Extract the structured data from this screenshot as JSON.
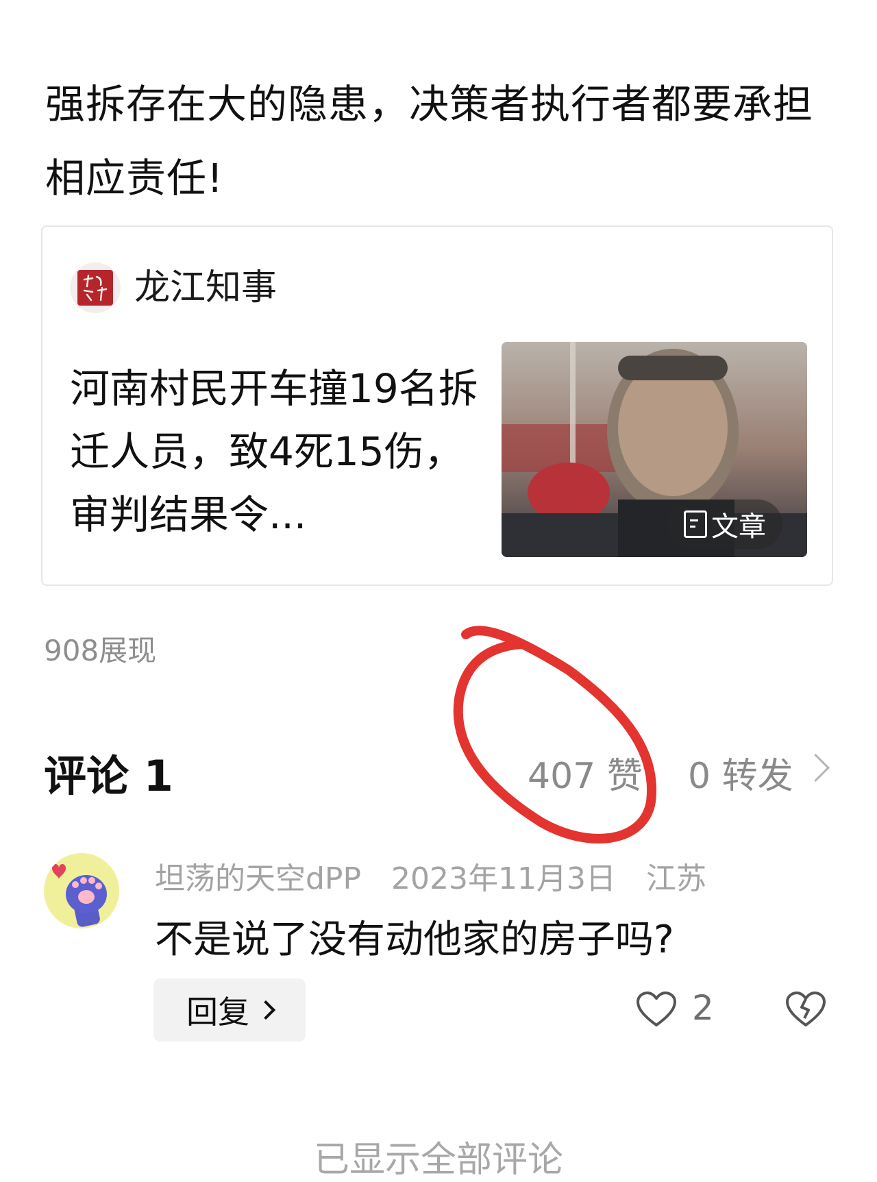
{
  "post": {
    "text": "强拆存在大的隐患，决策者执行者都要承担相应责任!"
  },
  "card": {
    "source_name": "龙江知事",
    "logo_text": "龙江知事",
    "article_title": "河南村民开车撞19名拆迁人员，致4死15伤，审判结果令...",
    "badge_label": "文章"
  },
  "stats": {
    "views": "908展现",
    "comments_title": "评论 1",
    "likes": "407 赞",
    "shares": "0 转发"
  },
  "comment": {
    "username": "坦荡的天空dPP",
    "date": "2023年11月3日",
    "location": "江苏",
    "text": "不是说了没有动他家的房子吗?",
    "reply_label": "回复",
    "like_count": "2"
  },
  "footer": {
    "all_shown": "已显示全部评论"
  },
  "colors": {
    "annotation_red": "#e3342f",
    "logo_red": "#b5262b",
    "muted_text": "#8e8e8e"
  }
}
